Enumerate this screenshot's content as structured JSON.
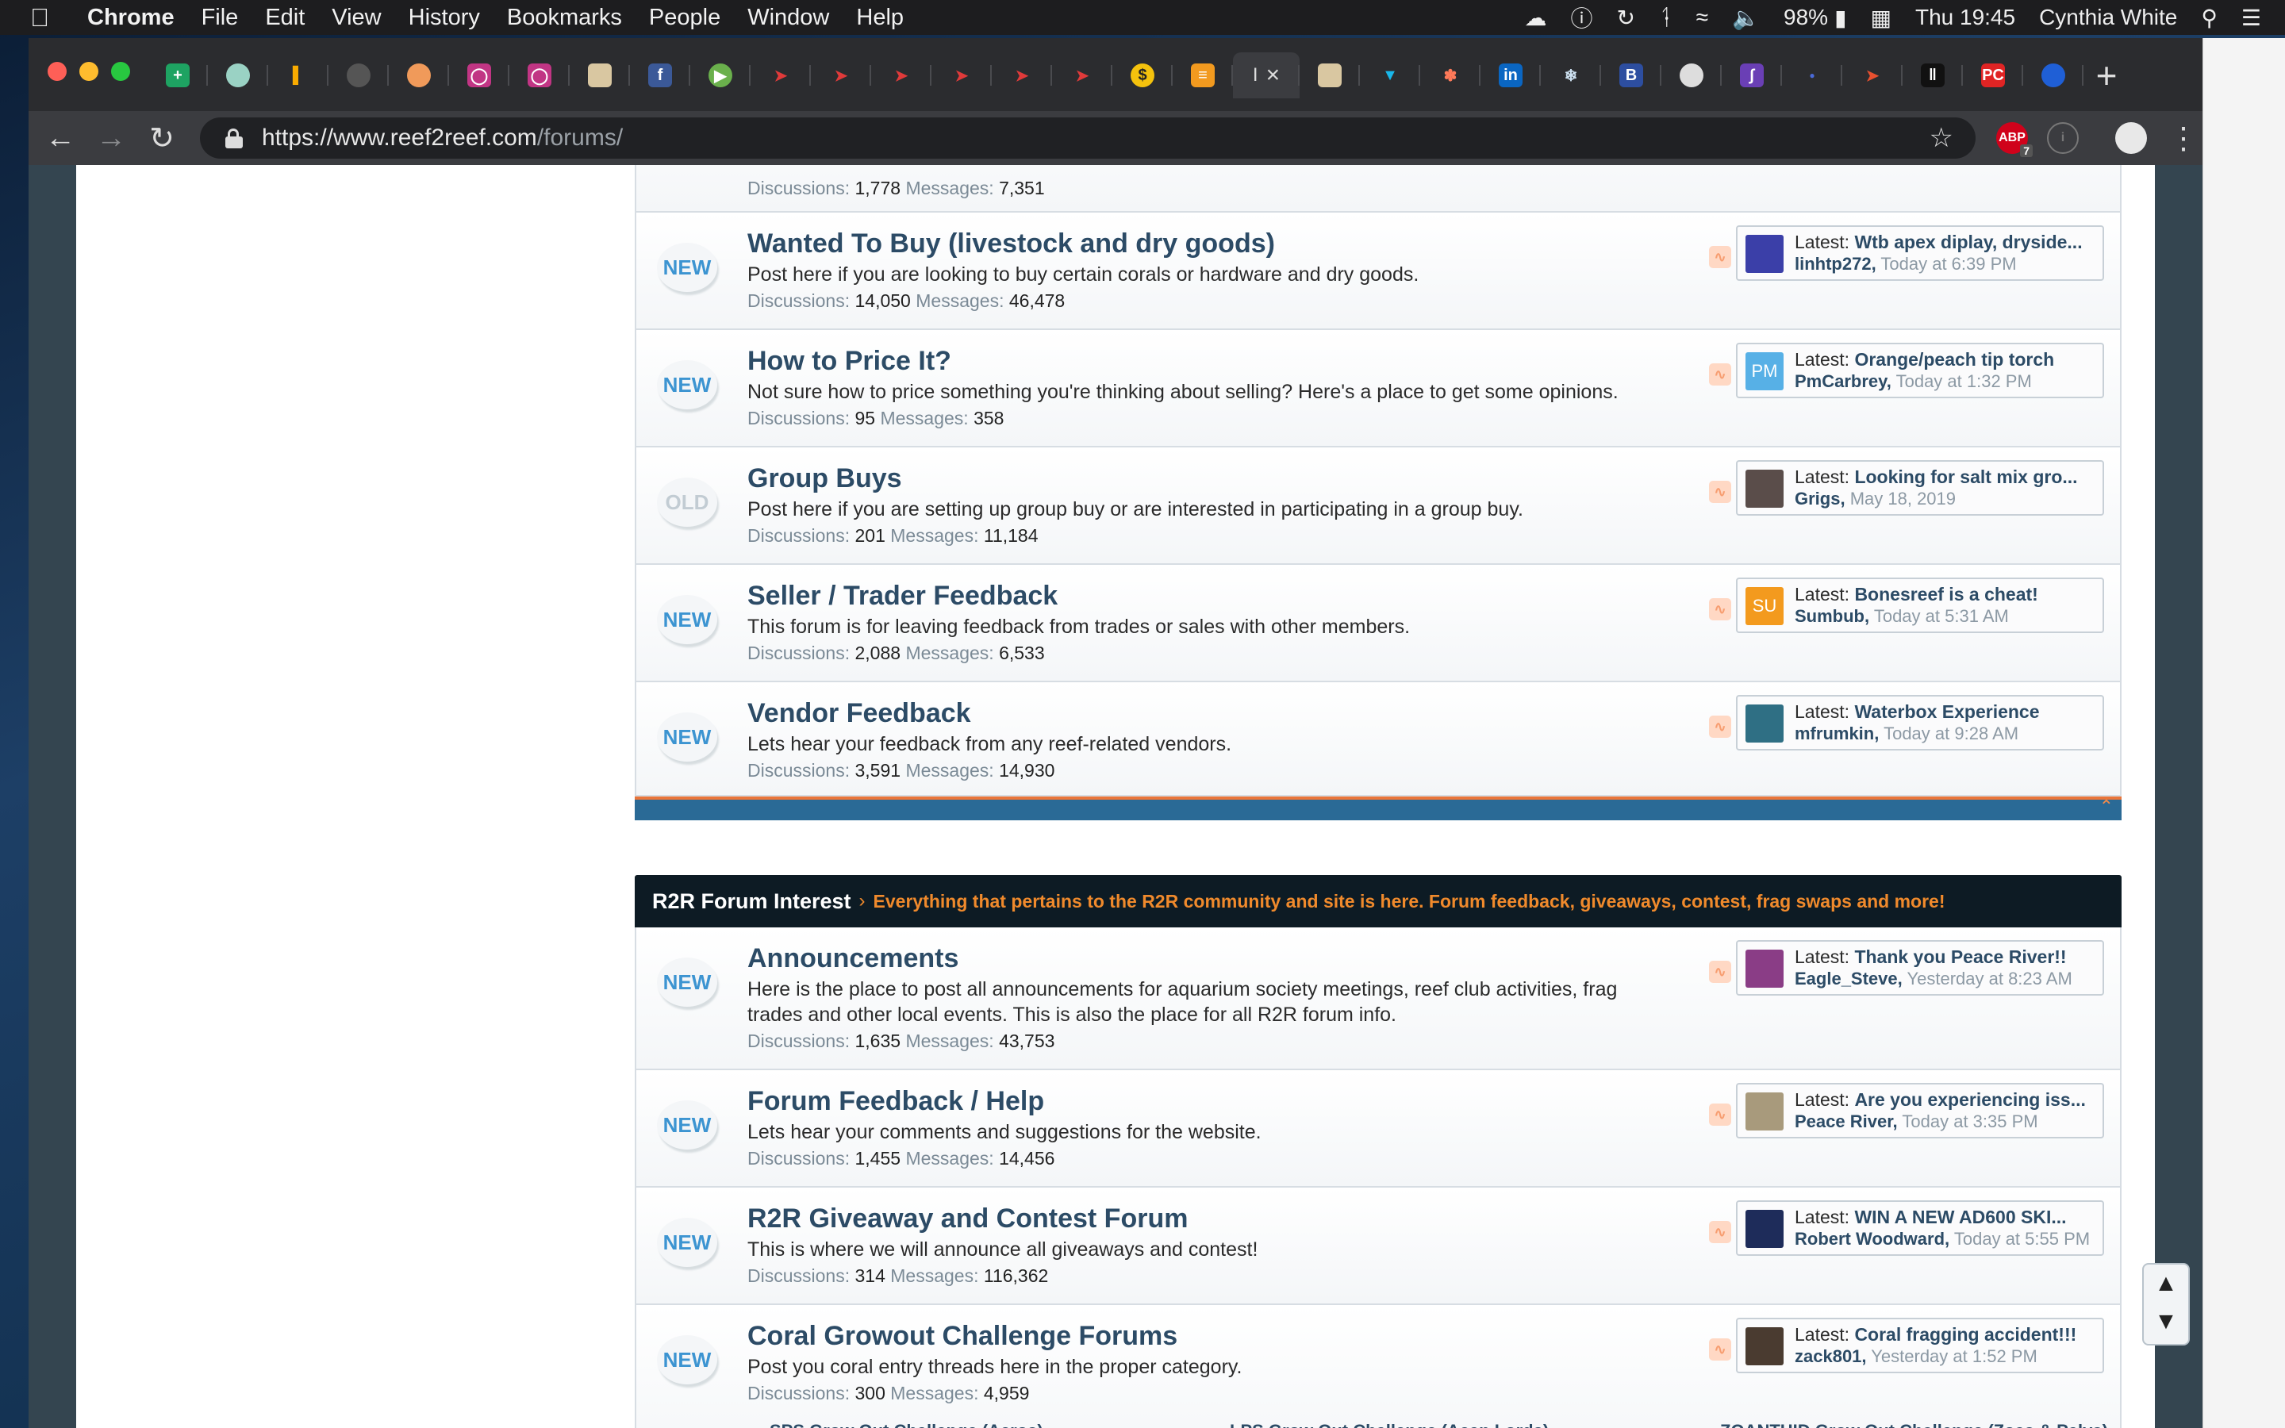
{
  "menubar": {
    "app": "Chrome",
    "items": [
      "File",
      "Edit",
      "View",
      "History",
      "Bookmarks",
      "People",
      "Window",
      "Help"
    ],
    "battery": "98%",
    "clock": "Thu 19:45",
    "user": "Cynthia White"
  },
  "browser": {
    "url_host": "https://www.reef2reef.com",
    "url_path": "/forums/",
    "active_tab_label": "I",
    "extension_badge": "7",
    "adblock_label": "ABP"
  },
  "forums_top": [
    {
      "badge": "",
      "title": "",
      "desc": "",
      "discussions": "1,778",
      "messages": "7,351"
    }
  ],
  "forums": [
    {
      "badge": "NEW",
      "title": "Wanted To Buy (livestock and dry goods)",
      "desc": "Post here if you are looking to buy certain corals or hardware and dry goods.",
      "discussions": "14,050",
      "messages": "46,478",
      "latest_title": "Wtb apex diplay, dryside...",
      "latest_user": "linhtp272,",
      "latest_time": "Today at 6:39 PM",
      "avatar_text": "",
      "avatar_color": "#3b3fa8"
    },
    {
      "badge": "NEW",
      "title": "How to Price It?",
      "desc": "Not sure how to price something you're thinking about selling? Here's a place to get some opinions.",
      "discussions": "95",
      "messages": "358",
      "latest_title": "Orange/peach tip torch",
      "latest_user": "PmCarbrey,",
      "latest_time": "Today at 1:32 PM",
      "avatar_text": "PM",
      "avatar_color": "#57b0e6"
    },
    {
      "badge": "OLD",
      "title": "Group Buys",
      "desc": "Post here if you are setting up group buy or are interested in participating in a group buy.",
      "discussions": "201",
      "messages": "11,184",
      "latest_title": "Looking for salt mix gro...",
      "latest_user": "Grigs,",
      "latest_time": "May 18, 2019",
      "avatar_text": "",
      "avatar_color": "#5a4d4a"
    },
    {
      "badge": "NEW",
      "title": "Seller / Trader Feedback",
      "desc": "This forum is for leaving feedback from trades or sales with other members.",
      "discussions": "2,088",
      "messages": "6,533",
      "latest_title": "Bonesreef is a cheat!",
      "latest_user": "Sumbub,",
      "latest_time": "Today at 5:31 AM",
      "avatar_text": "SU",
      "avatar_color": "#f39a1e"
    },
    {
      "badge": "NEW",
      "title": "Vendor Feedback",
      "desc": "Lets hear your feedback from any reef-related vendors.",
      "discussions": "3,591",
      "messages": "14,930",
      "latest_title": "Waterbox Experience",
      "latest_user": "mfrumkin,",
      "latest_time": "Today at 9:28 AM",
      "avatar_text": "",
      "avatar_color": "#2f6f84"
    }
  ],
  "category": {
    "title": "R2R Forum Interest",
    "desc": "Everything that pertains to the R2R community and site is here. Forum feedback, giveaways, contest, frag swaps and more!"
  },
  "forums2": [
    {
      "badge": "NEW",
      "title": "Announcements",
      "desc": "Here is the place to post all announcements for aquarium society meetings, reef club activities, frag trades and other local events. This is also the place for all R2R forum info.",
      "discussions": "1,635",
      "messages": "43,753",
      "latest_title": "Thank you Peace River!!",
      "latest_user": "Eagle_Steve,",
      "latest_time": "Yesterday at 8:23 AM",
      "avatar_text": "",
      "avatar_color": "#8a3d86"
    },
    {
      "badge": "NEW",
      "title": "Forum Feedback / Help",
      "desc": "Lets hear your comments and suggestions for the website.",
      "discussions": "1,455",
      "messages": "14,456",
      "latest_title": "Are you experiencing iss...",
      "latest_user": "Peace River,",
      "latest_time": "Today at 3:35 PM",
      "avatar_text": "",
      "avatar_color": "#a89a7c"
    },
    {
      "badge": "NEW",
      "title": "R2R Giveaway and Contest Forum",
      "desc": "This is where we will announce all giveaways and contest!",
      "discussions": "314",
      "messages": "116,362",
      "latest_title": "WIN A NEW AD600 SKI...",
      "latest_user": "Robert Woodward,",
      "latest_time": "Today at 5:55 PM",
      "avatar_text": "",
      "avatar_color": "#1e2c5a"
    },
    {
      "badge": "NEW",
      "title": "Coral Growout Challenge Forums",
      "desc": "Post you coral entry threads here in the proper category.",
      "discussions": "300",
      "messages": "4,959",
      "latest_title": "Coral fragging accident!!!",
      "latest_user": "zack801,",
      "latest_time": "Yesterday at 1:52 PM",
      "avatar_text": "",
      "avatar_color": "#4a3b30"
    }
  ],
  "subforums": [
    "SPS Grow Out Challenge (Acros)",
    "LPS Grow Out Challenge (Acan Lords)",
    "ZOANTHID Grow Out Challenge (Zoas & Palys)"
  ],
  "labels": {
    "discussions": "Discussions:",
    "messages": "Messages:",
    "latest": "Latest:"
  }
}
